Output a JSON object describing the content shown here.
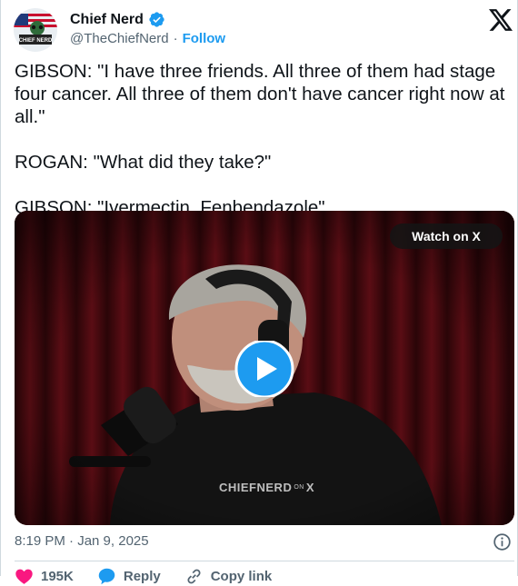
{
  "author": {
    "display_name": "Chief Nerd",
    "handle": "@TheChiefNerd",
    "separator": "·",
    "follow_label": "Follow",
    "avatar_caption": "CHIEF NERD"
  },
  "tweet": {
    "paragraphs": [
      "GIBSON: \"I have three friends. All three of them had stage four cancer. All three of them don't have cancer right now at all.\"",
      "ROGAN: \"What did they take?\"",
      "GIBSON: \"Ivermectin, Fenbendazole\""
    ]
  },
  "media": {
    "watch_label": "Watch on X",
    "watermark_main": "CHIEFNERD",
    "watermark_on": "ON",
    "watermark_x": "X"
  },
  "footer": {
    "timestamp": "8:19 PM · Jan 9, 2025"
  },
  "actions": {
    "like_count": "195K",
    "reply_label": "Reply",
    "copy_label": "Copy link"
  },
  "colors": {
    "accent": "#1d9bf0",
    "secondary_text": "#536471",
    "like_red": "#f91880"
  },
  "icons": [
    "verified-badge-icon",
    "x-logo-icon",
    "play-icon",
    "info-icon",
    "heart-icon",
    "reply-icon",
    "link-icon"
  ]
}
